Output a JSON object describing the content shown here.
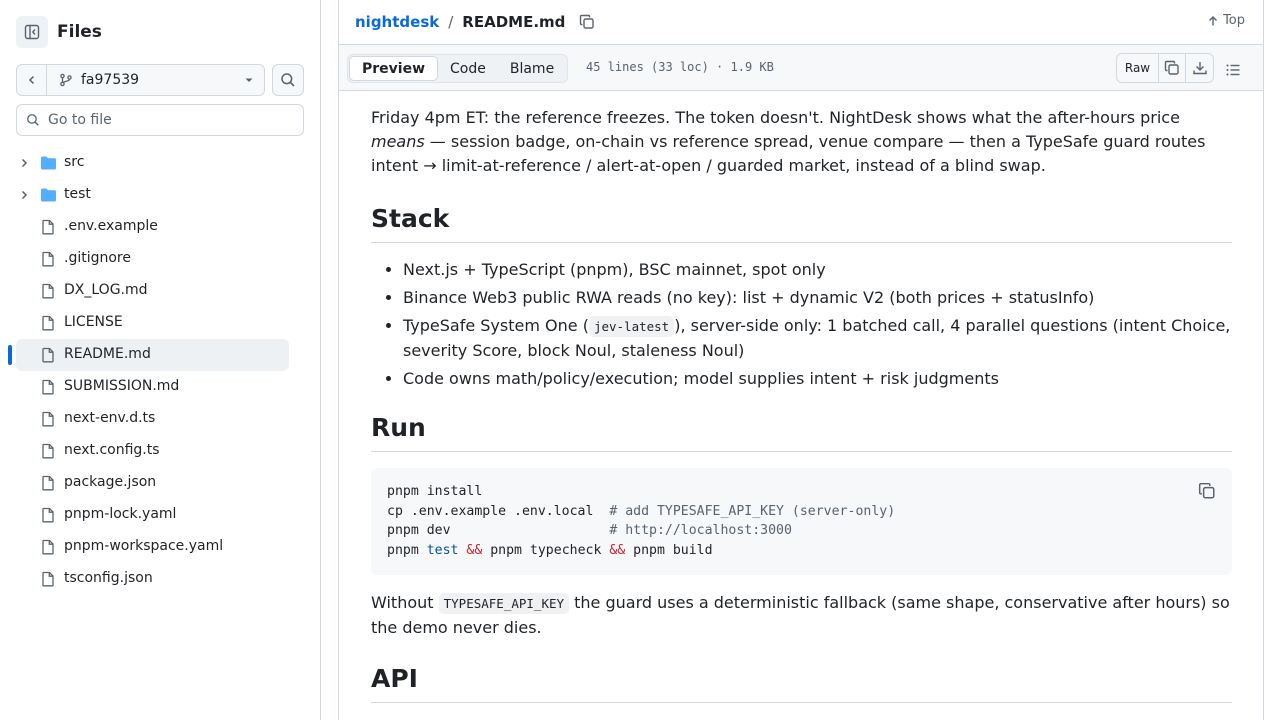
{
  "sidebar": {
    "title": "Files",
    "branch": "fa97539",
    "goto_placeholder": "Go to file",
    "items": [
      {
        "label": "src",
        "type": "folder"
      },
      {
        "label": "test",
        "type": "folder"
      },
      {
        "label": ".env.example",
        "type": "file"
      },
      {
        "label": ".gitignore",
        "type": "file"
      },
      {
        "label": "DX_LOG.md",
        "type": "file"
      },
      {
        "label": "LICENSE",
        "type": "file"
      },
      {
        "label": "README.md",
        "type": "file",
        "active": true
      },
      {
        "label": "SUBMISSION.md",
        "type": "file"
      },
      {
        "label": "next-env.d.ts",
        "type": "file"
      },
      {
        "label": "next.config.ts",
        "type": "file"
      },
      {
        "label": "package.json",
        "type": "file"
      },
      {
        "label": "pnpm-lock.yaml",
        "type": "file"
      },
      {
        "label": "pnpm-workspace.yaml",
        "type": "file"
      },
      {
        "label": "tsconfig.json",
        "type": "file"
      }
    ]
  },
  "header": {
    "repo": "nightdesk",
    "sep": "/",
    "file": "README.md",
    "top_label": "Top"
  },
  "toolbar": {
    "tabs": [
      "Preview",
      "Code",
      "Blame"
    ],
    "active_tab": "Preview",
    "file_info": "45 lines (33 loc) · 1.9 KB",
    "raw_label": "Raw"
  },
  "readme": {
    "intro_a": "Friday 4pm ET: the reference freezes. The token doesn't. NightDesk shows what the after-hours price",
    "intro_em": "means",
    "intro_b": " — session badge, on-chain vs reference spread, venue compare — then a TypeSafe guard routes intent → limit-at-reference / alert-at-open / guarded market, instead of a blind swap.",
    "stack_heading": "Stack",
    "stack_1": "Next.js + TypeScript (pnpm), BSC mainnet, spot only",
    "stack_2": "Binance Web3 public RWA reads (no key): list + dynamic V2 (both prices + statusInfo)",
    "stack_3a": "TypeSafe System One (",
    "stack_3code": "jev-latest",
    "stack_3b": "), server-side only: 1 batched call, 4 parallel questions (intent Choice, severity Score, block Noul, staleness Noul)",
    "stack_4": "Code owns math/policy/execution; model supplies intent + risk judgments",
    "run_heading": "Run",
    "code_l1": "pnpm install",
    "code_l2a": "cp .env.example .env.local  ",
    "code_l2c": "# add TYPESAFE_API_KEY (server-only)",
    "code_l3a": "pnpm dev                    ",
    "code_l3c": "# http://localhost:3000",
    "code_l4a": "pnpm ",
    "code_l4kw": "test",
    "code_l4op1": " && ",
    "code_l4b": "pnpm typecheck",
    "code_l4op2": " && ",
    "code_l4c": "pnpm build",
    "without_a": "Without ",
    "without_code": "TYPESAFE_API_KEY",
    "without_b": " the guard uses a deterministic fallback (same shape, conservative after hours) so the demo never dies.",
    "api_heading": "API"
  }
}
